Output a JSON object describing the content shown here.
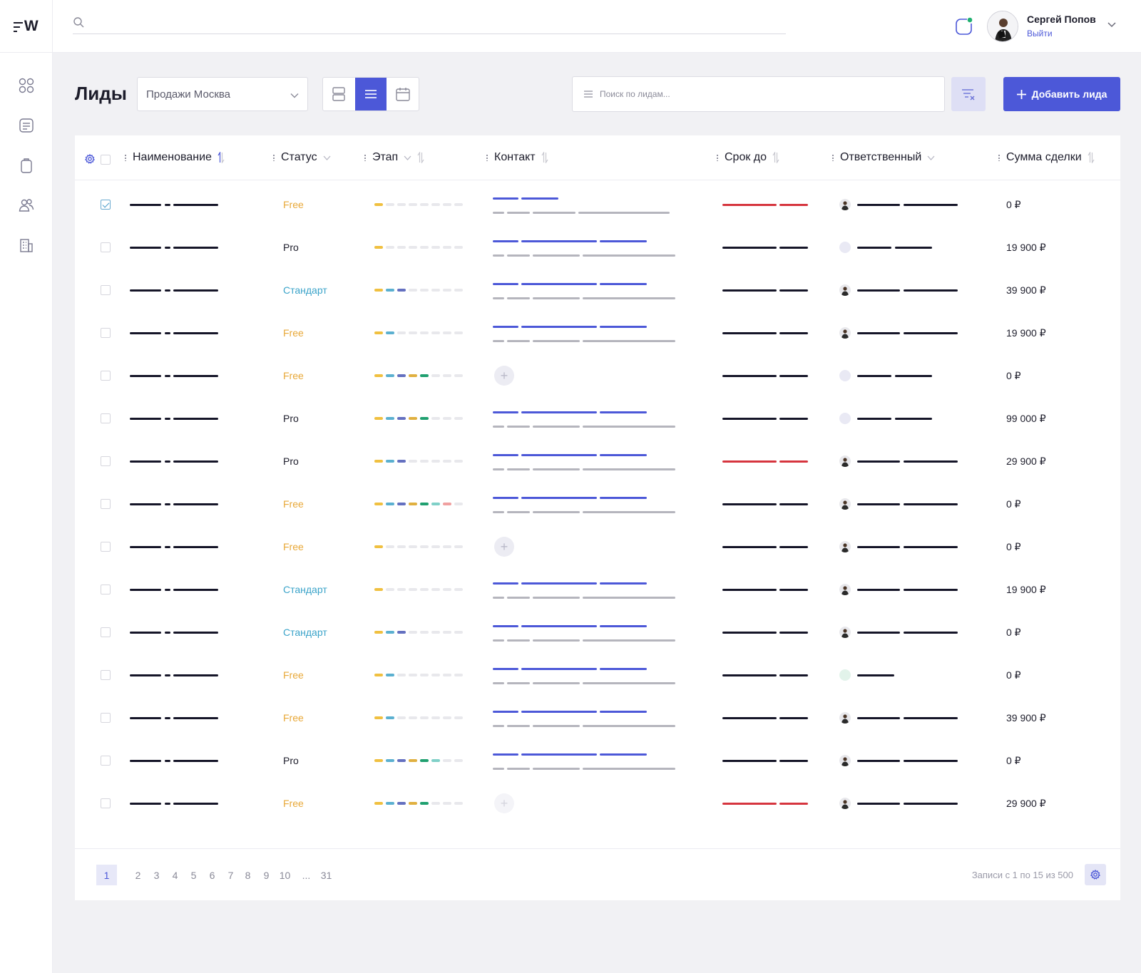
{
  "app": {
    "logo": "W"
  },
  "user": {
    "name": "Сергей Попов",
    "logout": "Выйти"
  },
  "page": {
    "title": "Лиды",
    "pipeline": "Продажи Москва",
    "search_placeholder": "Поиск по лидам...",
    "add_button": "Добавить лида"
  },
  "table": {
    "columns": [
      "Наименование",
      "Статус",
      "Этап",
      "Контакт",
      "Срок до",
      "Ответственный",
      "Сумма сделки"
    ],
    "rows": [
      {
        "checked": true,
        "status": "Free",
        "stage": 1,
        "contact": "short",
        "overdue": true,
        "owner": "photo",
        "amount": "0 ₽"
      },
      {
        "checked": false,
        "status": "Pro",
        "stage": 1,
        "contact": "full",
        "overdue": false,
        "owner": "blank",
        "amount": "19 900 ₽"
      },
      {
        "checked": false,
        "status": "Стандарт",
        "stage": 3,
        "contact": "full",
        "overdue": false,
        "owner": "photo",
        "amount": "39 900 ₽"
      },
      {
        "checked": false,
        "status": "Free",
        "stage": 2,
        "contact": "full",
        "overdue": false,
        "owner": "photo",
        "amount": "19 900 ₽"
      },
      {
        "checked": false,
        "status": "Free",
        "stage": 5,
        "contact": "add",
        "overdue": false,
        "owner": "blank",
        "amount": "0 ₽"
      },
      {
        "checked": false,
        "status": "Pro",
        "stage": 5,
        "contact": "full",
        "overdue": false,
        "owner": "blank",
        "amount": "99 000 ₽"
      },
      {
        "checked": false,
        "status": "Pro",
        "stage": 3,
        "contact": "full",
        "overdue": true,
        "owner": "photo",
        "amount": "29 900 ₽"
      },
      {
        "checked": false,
        "status": "Free",
        "stage": 7,
        "contact": "full",
        "overdue": false,
        "owner": "photo",
        "amount": "0 ₽"
      },
      {
        "checked": false,
        "status": "Free",
        "stage": 1,
        "contact": "add",
        "overdue": false,
        "owner": "photo",
        "amount": "0 ₽"
      },
      {
        "checked": false,
        "status": "Стандарт",
        "stage": 1,
        "contact": "full",
        "overdue": false,
        "owner": "photo",
        "amount": "19 900 ₽"
      },
      {
        "checked": false,
        "status": "Стандарт",
        "stage": 3,
        "contact": "full",
        "overdue": false,
        "owner": "photo",
        "amount": "0 ₽"
      },
      {
        "checked": false,
        "status": "Free",
        "stage": 2,
        "contact": "full",
        "overdue": false,
        "owner": "green",
        "amount": "0 ₽"
      },
      {
        "checked": false,
        "status": "Free",
        "stage": 2,
        "contact": "full",
        "overdue": false,
        "owner": "photo",
        "amount": "39 900 ₽"
      },
      {
        "checked": false,
        "status": "Pro",
        "stage": 6,
        "contact": "full",
        "overdue": false,
        "owner": "photo",
        "amount": "0 ₽"
      },
      {
        "checked": false,
        "status": "Free",
        "stage": 5,
        "contact": "addlight",
        "overdue": true,
        "owner": "photo",
        "amount": "29 900 ₽"
      }
    ]
  },
  "pagination": {
    "pages": [
      "1",
      "2",
      "3",
      "4",
      "5",
      "6",
      "7",
      "8",
      "9",
      "10",
      "...",
      "31"
    ],
    "current": "1",
    "records": "Записи с 1 по 15 из 500"
  },
  "colors": {
    "accent": "#4c58d8",
    "status_free": "#e8a838",
    "status_pro": "#1d1d2b",
    "status_standard": "#3aa3c9",
    "overdue": "#d6353e",
    "stages": [
      "#f0c040",
      "#5bb0d0",
      "#6470c0",
      "#e0b040",
      "#20a070",
      "#80d0c8",
      "#f0a0a0",
      "#e8e8ec"
    ]
  }
}
